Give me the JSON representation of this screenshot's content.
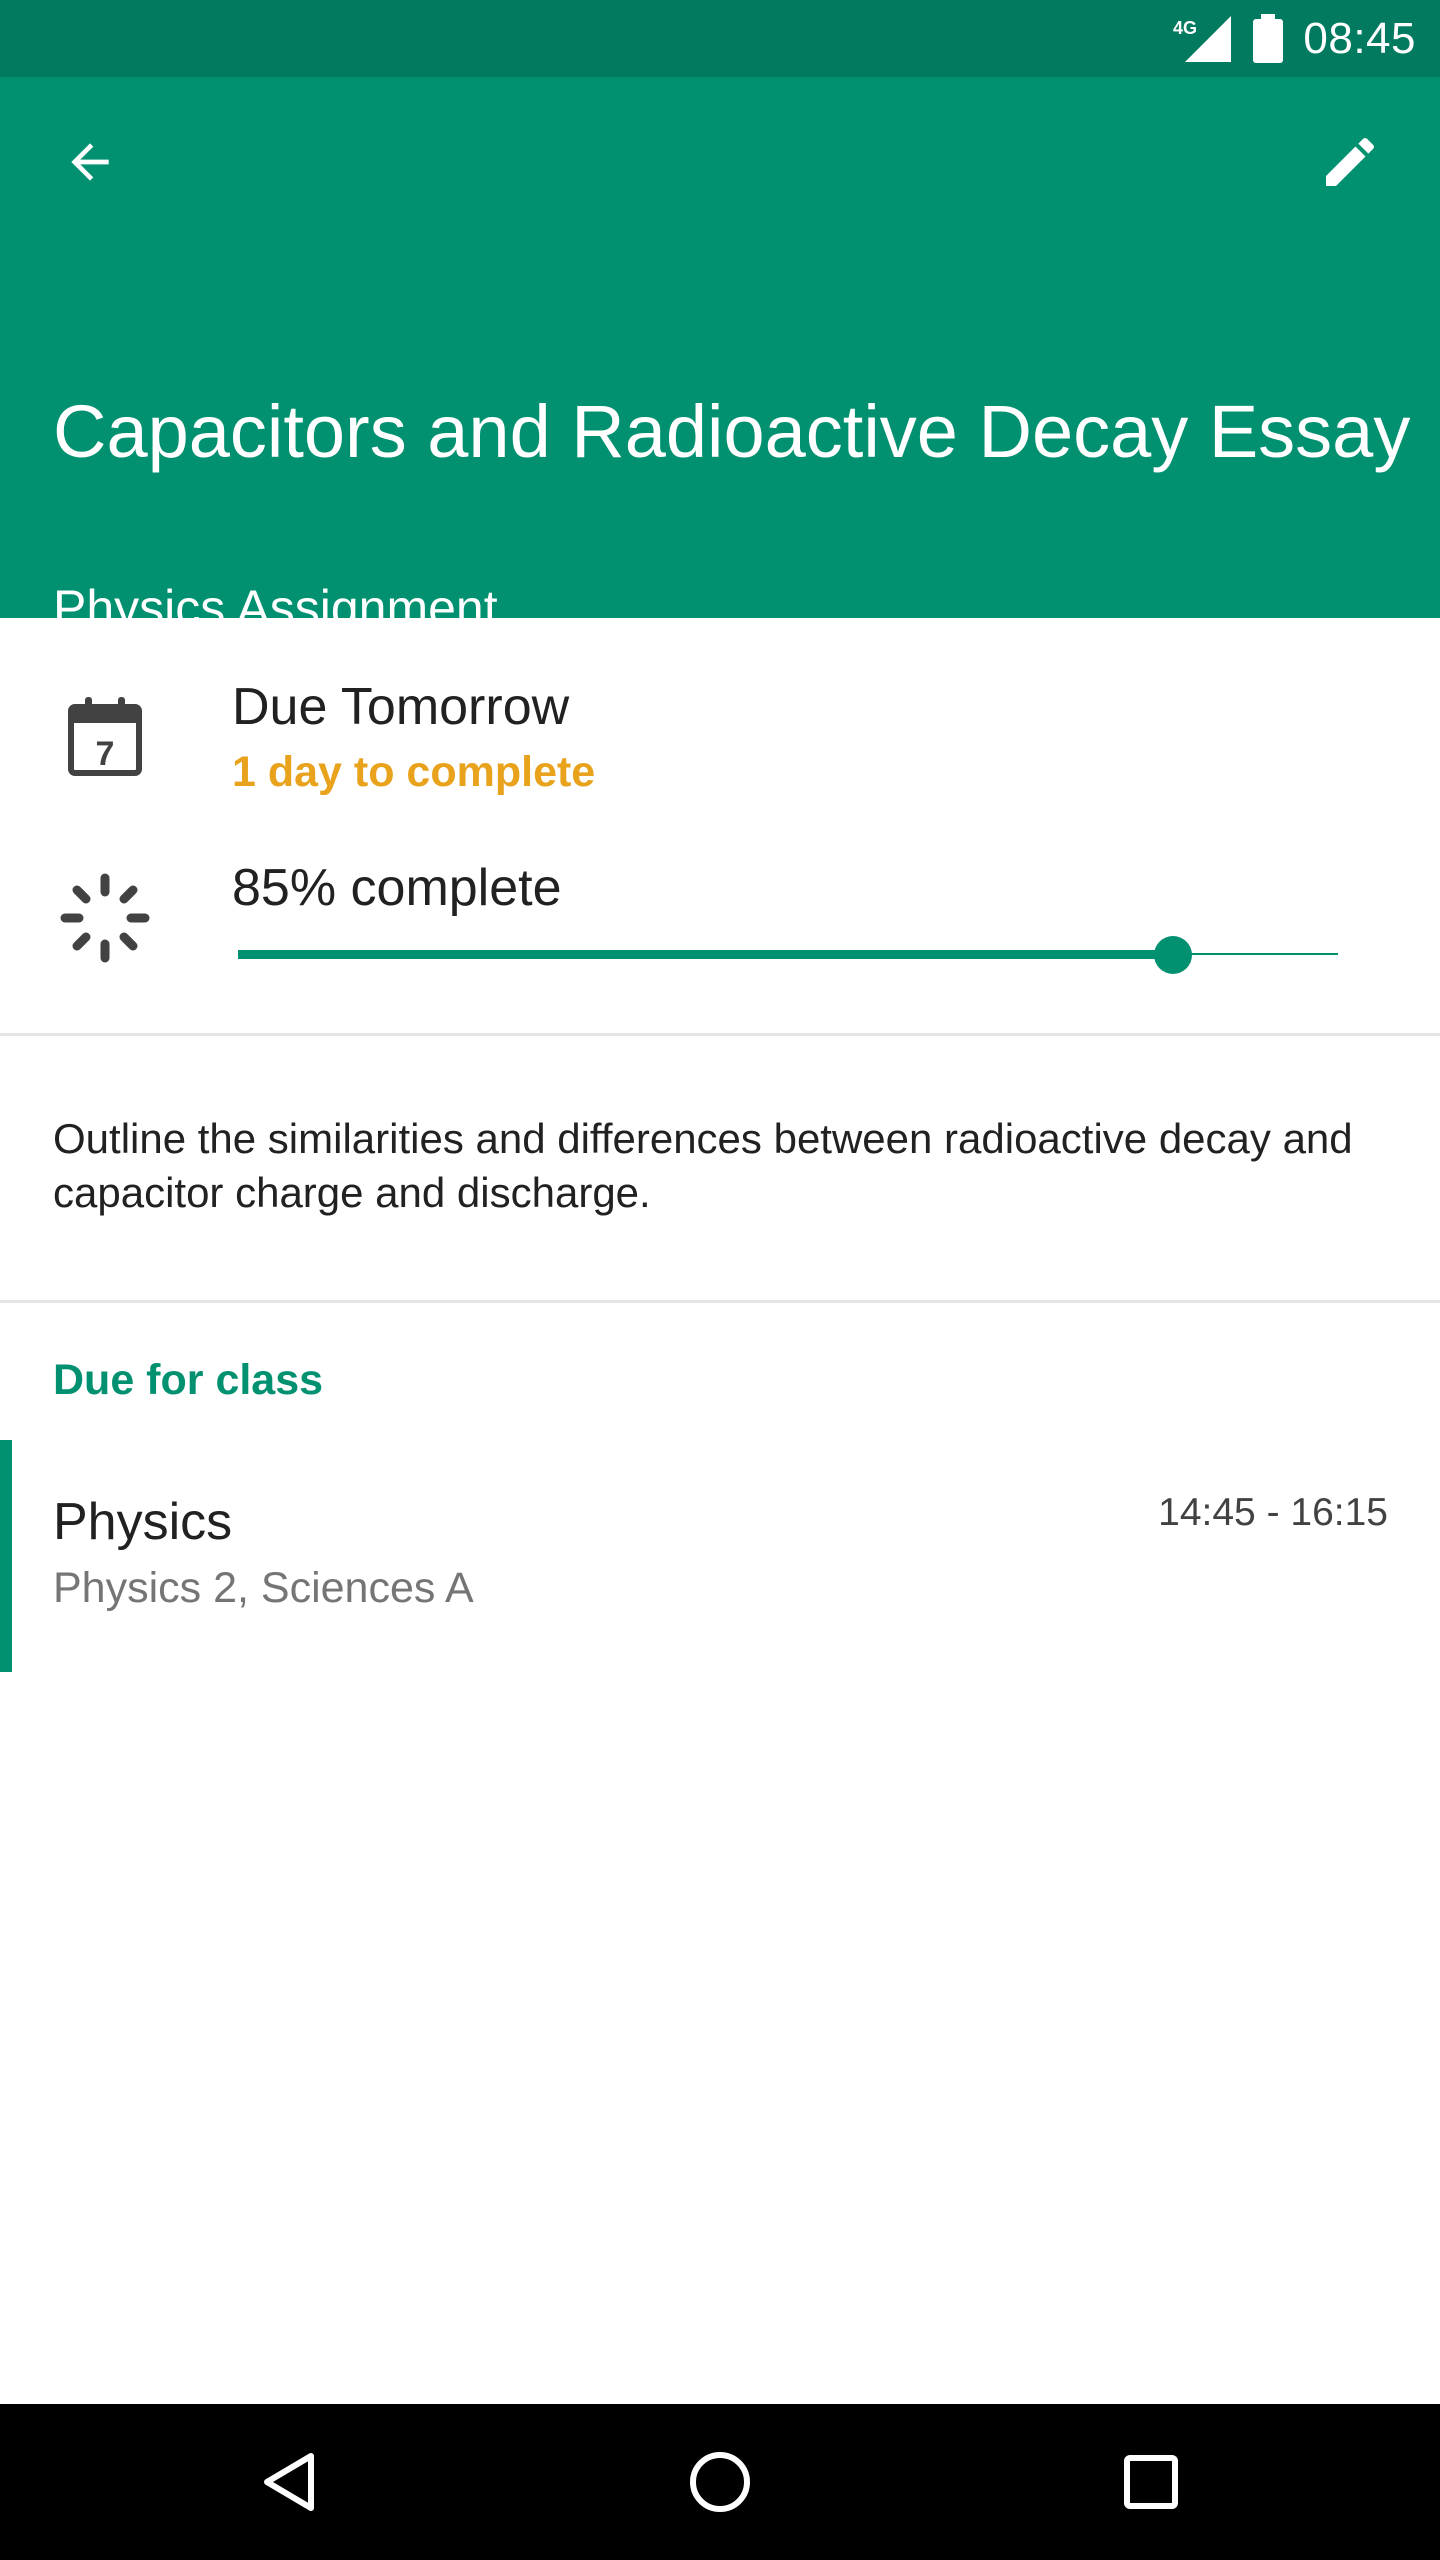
{
  "status_bar": {
    "network": "4G",
    "time": "08:45",
    "icons": [
      "signal-icon",
      "battery-icon"
    ]
  },
  "header": {
    "back_icon": "back-arrow-icon",
    "edit_icon": "edit-pencil-icon",
    "title": "Capacitors and Radioactive Decay Essay",
    "subtitle": "Physics Assignment"
  },
  "due": {
    "icon": "calendar-icon",
    "calendar_day": "7",
    "title": "Due Tomorrow",
    "subtitle": "1 day to complete"
  },
  "progress": {
    "icon": "progress-icon",
    "label": "85% complete",
    "value": 0.85
  },
  "description": "Outline the similarities and differences between radioactive decay and capacitor charge and discharge.",
  "due_for_class": {
    "header": "Due for class",
    "class": {
      "name": "Physics",
      "details": "Physics 2, Sciences A",
      "time": "14:45 - 16:15"
    }
  },
  "nav_bar": {
    "icons": [
      "nav-back-icon",
      "nav-home-icon",
      "nav-recents-icon"
    ]
  },
  "colors": {
    "status_bar": "#017A60",
    "primary": "#029170",
    "accent_text": "#E8A21C",
    "divider": "#E4E4E4"
  }
}
